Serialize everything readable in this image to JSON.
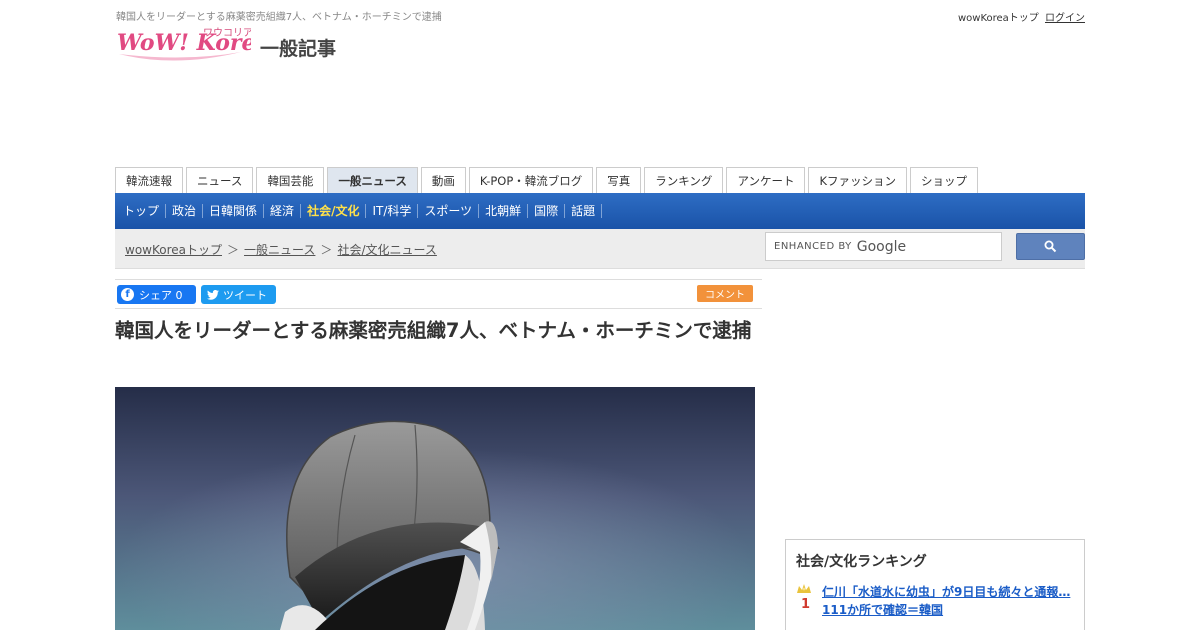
{
  "header": {
    "top_breadcrumb": "韓国人をリーダーとする麻薬密売組織7人、ベトナム・ホーチミンで逮捕",
    "top_link_home": "wowKoreaトップ",
    "top_link_login": "ログイン",
    "logo_text": "WoW! Korea",
    "logo_kana": "ワウコリア",
    "section_title": "一般記事"
  },
  "main_tabs": [
    {
      "label": "韓流速報"
    },
    {
      "label": "ニュース"
    },
    {
      "label": "韓国芸能"
    },
    {
      "label": "一般ニュース"
    },
    {
      "label": "動画"
    },
    {
      "label": "K-POP・韓流ブログ"
    },
    {
      "label": "写真"
    },
    {
      "label": "ランキング"
    },
    {
      "label": "アンケート"
    },
    {
      "label": "Kファッション"
    },
    {
      "label": "ショップ"
    }
  ],
  "sub_nav": [
    {
      "label": "トップ"
    },
    {
      "label": "政治"
    },
    {
      "label": "日韓関係"
    },
    {
      "label": "経済"
    },
    {
      "label": "社会/文化"
    },
    {
      "label": "IT/科学"
    },
    {
      "label": "スポーツ"
    },
    {
      "label": "北朝鮮"
    },
    {
      "label": "国際"
    },
    {
      "label": "話題"
    }
  ],
  "breadcrumb": {
    "items": [
      "wowKoreaトップ",
      "一般ニュース",
      "社会/文化ニュース"
    ],
    "separator": "＞"
  },
  "search": {
    "enhanced_by": "ENHANCED BY",
    "google": "Google"
  },
  "share": {
    "facebook_label": "シェア 0",
    "twitter_label": "ツイート",
    "comment_label": "コメント"
  },
  "article": {
    "headline": "韓国人をリーダーとする麻薬密売組織7人、ベトナム・ホーチミンで逮捕"
  },
  "ranking": {
    "title": "社会/文化ランキング",
    "items": [
      {
        "rank": "1",
        "text": "仁川「水道水に幼虫」が9日目も続々と通報…111か所で確認＝韓国"
      }
    ]
  },
  "colors": {
    "accent_blue": "#1a53a8",
    "active_subnav": "#ffe14a",
    "facebook": "#1877f2",
    "twitter": "#1d9bf0",
    "comment": "#f2923b",
    "link": "#1a5cc7"
  }
}
